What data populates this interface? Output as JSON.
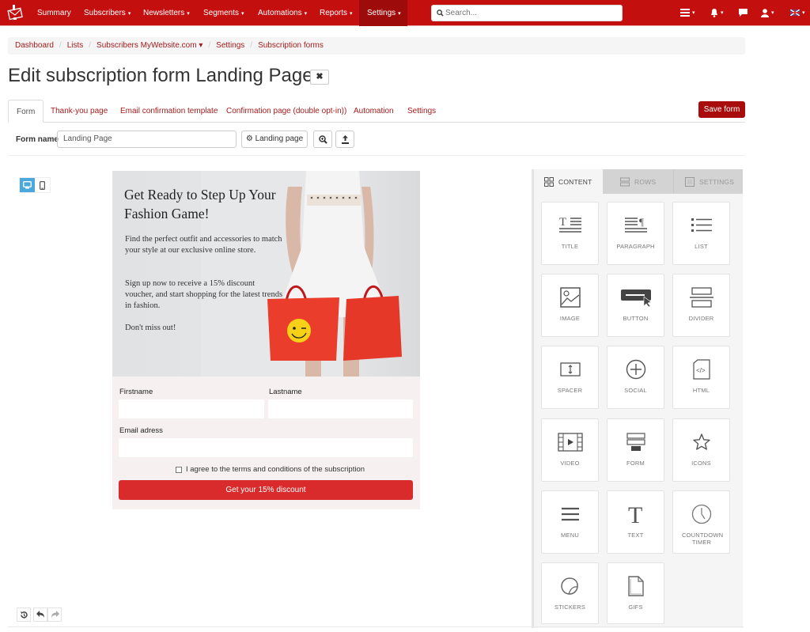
{
  "topnav": {
    "items": [
      {
        "label": "Summary",
        "dropdown": false
      },
      {
        "label": "Subscribers",
        "dropdown": true
      },
      {
        "label": "Newsletters",
        "dropdown": true
      },
      {
        "label": "Segments",
        "dropdown": true
      },
      {
        "label": "Automations",
        "dropdown": true
      },
      {
        "label": "Reports",
        "dropdown": true
      },
      {
        "label": "Settings",
        "dropdown": true,
        "active": true
      }
    ],
    "caret": "▾",
    "search_placeholder": "Search...",
    "right_icons": [
      "list-icon",
      "bell-icon",
      "chat-icon",
      "user-icon",
      "flag-icon"
    ],
    "brand_color": "#c40f0f"
  },
  "breadcrumb": {
    "items": [
      "Dashboard",
      "Lists",
      "Subscribers MyWebsite.com ▾",
      "Settings",
      "Subscription forms"
    ],
    "sep": "/"
  },
  "page": {
    "title": "Edit subscription form Landing Page",
    "close_label": "✖"
  },
  "tabs": [
    {
      "label": "Form",
      "active": true
    },
    {
      "label": "Thank-you page"
    },
    {
      "label": "Email confirmation template"
    },
    {
      "label": "Confirmation page (double opt-in))"
    },
    {
      "label": "Automation"
    },
    {
      "label": "Settings"
    }
  ],
  "save_label": "Save form",
  "formbar": {
    "label": "Form name",
    "value": "Landing Page",
    "template_button": "Landing page"
  },
  "canvas": {
    "headline": "Get Ready to Step Up Your Fashion Game!",
    "para1": "Find the perfect outfit and accessories to match your style at our exclusive online store.",
    "para2": "Sign up now to receive a 15% discount voucher, and start shopping for the latest trends in fashion.",
    "para3": "Don't miss out!",
    "fields": {
      "firstname": "Firstname",
      "lastname": "Lastname",
      "email": "Email adress"
    },
    "agree": "I agree to the terms and conditions of the subscription",
    "cta": "Get your 15% discount"
  },
  "panel": {
    "tabs": [
      "CONTENT",
      "ROWS",
      "SETTINGS"
    ],
    "tiles": [
      "TITLE",
      "PARAGRAPH",
      "LIST",
      "IMAGE",
      "BUTTON",
      "DIVIDER",
      "SPACER",
      "SOCIAL",
      "HTML",
      "VIDEO",
      "FORM",
      "ICONS",
      "MENU",
      "TEXT",
      "COUNTDOWN TIMER",
      "STICKERS",
      "GIFS"
    ]
  }
}
